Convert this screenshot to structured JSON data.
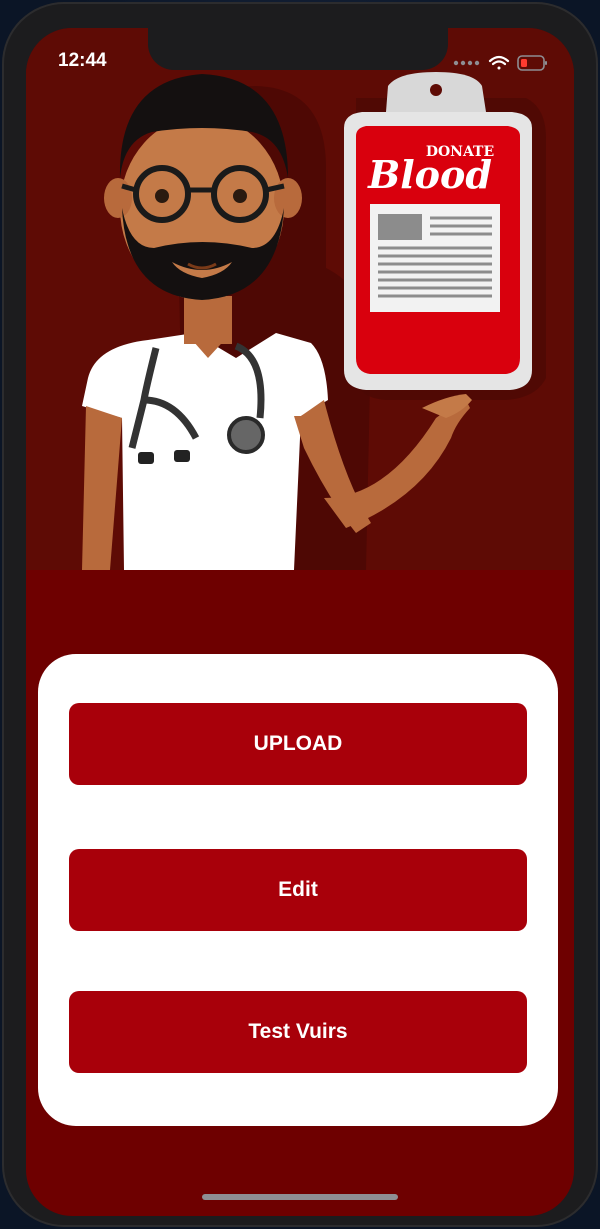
{
  "status_bar": {
    "time": "12:44"
  },
  "hero": {
    "bag_brand_small": "DONATE",
    "bag_brand_large": "Blood"
  },
  "actions": {
    "upload_label": "UPLOAD",
    "edit_label": "Edit",
    "test_label": "Test Vuirs"
  },
  "colors": {
    "screen_background": "#6e0000",
    "hero_background": "#5e0b05",
    "button": "#a8000a",
    "card": "#ffffff"
  },
  "icons": [
    "location-arrow-icon",
    "signal-dots-icon",
    "wifi-icon",
    "battery-low-icon"
  ]
}
